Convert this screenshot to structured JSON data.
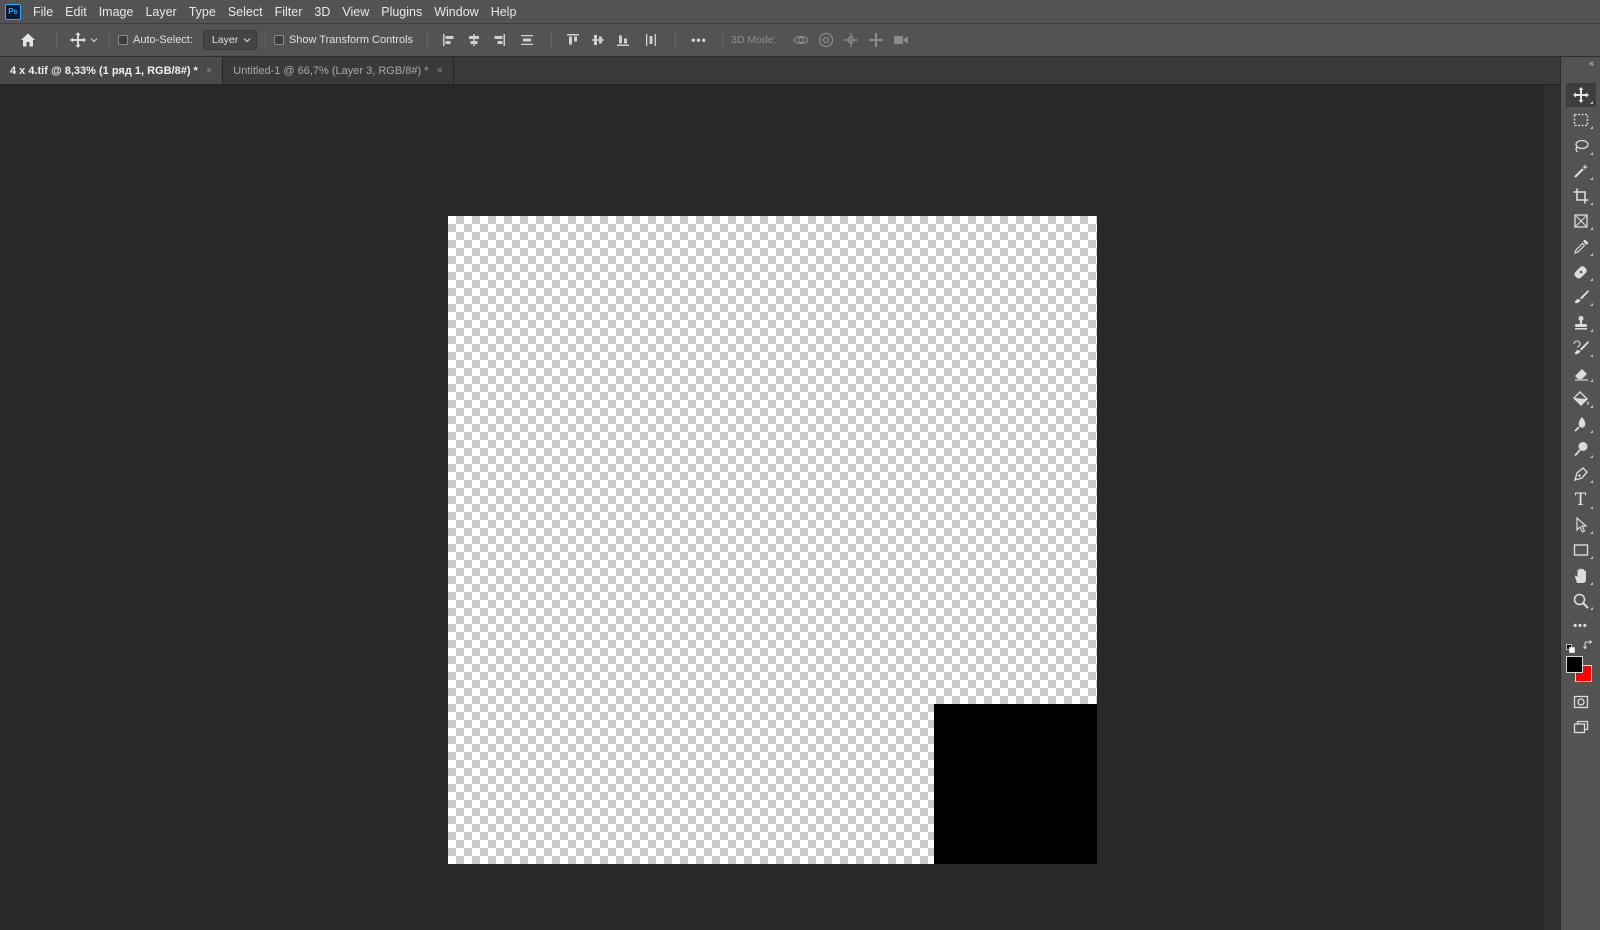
{
  "app": {
    "logo_text": "Ps"
  },
  "menu": [
    "File",
    "Edit",
    "Image",
    "Layer",
    "Type",
    "Select",
    "Filter",
    "3D",
    "View",
    "Plugins",
    "Window",
    "Help"
  ],
  "options": {
    "auto_select_label": "Auto-Select:",
    "auto_select_target": "Layer",
    "show_transform_label": "Show Transform Controls",
    "more_label": "•••",
    "mode_3d_label": "3D Mode:"
  },
  "tabs": [
    {
      "label": "4 x 4.tif @ 8,33% (1 ряд 1, RGB/8#) *",
      "close": "×",
      "active": true
    },
    {
      "label": "Untitled-1 @ 66,7% (Layer 3, RGB/8#) *",
      "close": "×",
      "active": false
    }
  ],
  "tools": [
    "move-tool-icon",
    "marquee-tool-icon",
    "lasso-tool-icon",
    "magic-wand-tool-icon",
    "crop-tool-icon",
    "frame-tool-icon",
    "eyedropper-tool-icon",
    "healing-brush-tool-icon",
    "brush-tool-icon",
    "clone-stamp-tool-icon",
    "history-brush-tool-icon",
    "eraser-tool-icon",
    "paint-bucket-tool-icon",
    "blur-tool-icon",
    "dodge-tool-icon",
    "pen-tool-icon",
    "type-tool-icon",
    "path-selection-tool-icon",
    "rectangle-tool-icon",
    "hand-tool-icon",
    "zoom-tool-icon",
    "edit-toolbar-icon"
  ],
  "type_tool_glyph": "T",
  "edit_toolbar_glyph": "•••",
  "collapse_glyph": "«",
  "colors": {
    "foreground": "#000000",
    "background": "#ff0000",
    "canvas_object": "#000000",
    "accent": "#31a8ff"
  }
}
